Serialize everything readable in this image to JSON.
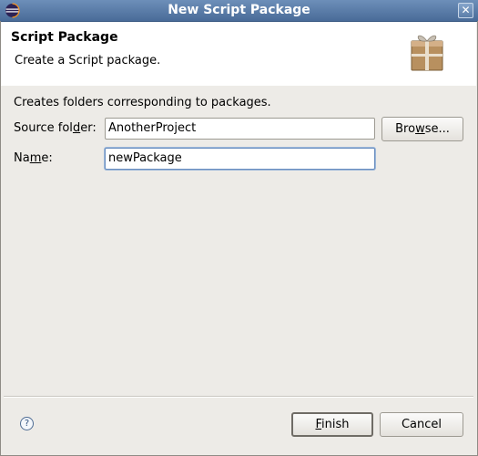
{
  "window": {
    "title": "New Script Package",
    "close_glyph": "✕",
    "app_icon": "eclipse-icon"
  },
  "banner": {
    "title": "Script Package",
    "description": "Create a Script package.",
    "image": "package-icon"
  },
  "form": {
    "info": "Creates folders corresponding to packages.",
    "source_folder": {
      "label_before": "Source fol",
      "label_mnemonic": "d",
      "label_after": "er:",
      "value": "AnotherProject"
    },
    "name": {
      "label_before": "Na",
      "label_mnemonic": "m",
      "label_after": "e:",
      "value": "newPackage"
    },
    "browse": {
      "label_before": "Bro",
      "label_mnemonic": "w",
      "label_after": "se..."
    }
  },
  "footer": {
    "help_glyph": "?",
    "finish": {
      "label_mnemonic": "F",
      "label_after": "inish"
    },
    "cancel_label": "Cancel"
  }
}
